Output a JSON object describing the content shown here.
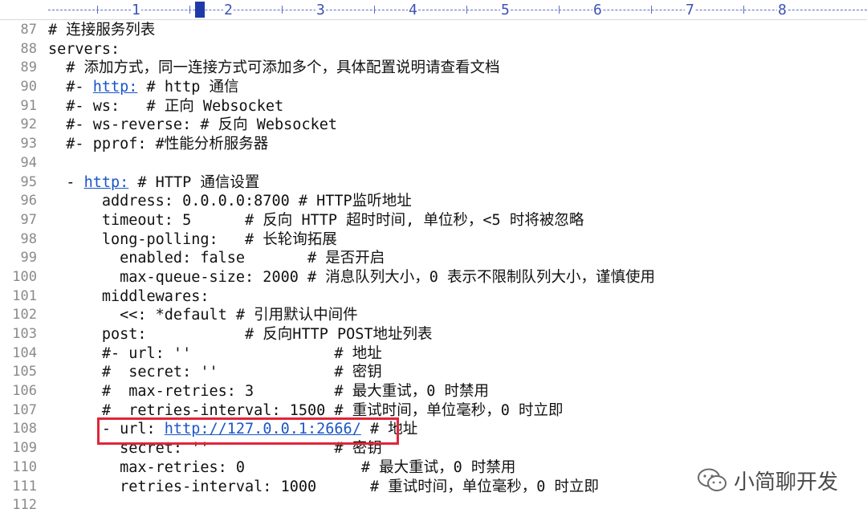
{
  "ruler": {
    "numbers": [
      "1",
      "2",
      "3",
      "4",
      "5",
      "6",
      "7",
      "8"
    ]
  },
  "lines": [
    {
      "n": "87",
      "text": "# 连接服务列表"
    },
    {
      "n": "88",
      "text": "servers:"
    },
    {
      "n": "89",
      "text": "  # 添加方式，同一连接方式可添加多个，具体配置说明请查看文档"
    },
    {
      "n": "90",
      "pre": "  #- ",
      "link": "http:",
      "post": " # http 通信"
    },
    {
      "n": "91",
      "text": "  #- ws:   # 正向 Websocket"
    },
    {
      "n": "92",
      "text": "  #- ws-reverse: # 反向 Websocket"
    },
    {
      "n": "93",
      "text": "  #- pprof: #性能分析服务器"
    },
    {
      "n": "94",
      "text": ""
    },
    {
      "n": "95",
      "pre": "  - ",
      "link": "http:",
      "post": " # HTTP 通信设置"
    },
    {
      "n": "96",
      "text": "      address: 0.0.0.0:8700 # HTTP监听地址"
    },
    {
      "n": "97",
      "text": "      timeout: 5      # 反向 HTTP 超时时间, 单位秒，<5 时将被忽略"
    },
    {
      "n": "98",
      "text": "      long-polling:   # 长轮询拓展"
    },
    {
      "n": "99",
      "text": "        enabled: false       # 是否开启"
    },
    {
      "n": "100",
      "text": "        max-queue-size: 2000 # 消息队列大小，0 表示不限制队列大小，谨慎使用"
    },
    {
      "n": "101",
      "text": "      middlewares:"
    },
    {
      "n": "102",
      "text": "        <<: *default # 引用默认中间件"
    },
    {
      "n": "103",
      "text": "      post:           # 反向HTTP POST地址列表"
    },
    {
      "n": "104",
      "text": "      #- url: ''                # 地址"
    },
    {
      "n": "105",
      "text": "      #  secret: ''             # 密钥"
    },
    {
      "n": "106",
      "text": "      #  max-retries: 3         # 最大重试，0 时禁用"
    },
    {
      "n": "107",
      "text": "      #  retries-interval: 1500 # 重试时间，单位毫秒，0 时立即"
    },
    {
      "n": "108",
      "pre": "      - url: ",
      "link": "http://127.0.0.1:2666/",
      "post": " # 地址"
    },
    {
      "n": "109",
      "text": "        secret: ''              # 密钥"
    },
    {
      "n": "110",
      "text": "        max-retries: 0             # 最大重试，0 时禁用"
    },
    {
      "n": "111",
      "text": "        retries-interval: 1000      # 重试时间，单位毫秒，0 时立即"
    },
    {
      "n": "112",
      "text": ""
    }
  ],
  "watermark": {
    "text": "小简聊开发",
    "icon": "wechat-icon"
  },
  "colors": {
    "link": "#1a56c8",
    "highlight": "#e0263a",
    "ruler": "#3b52b6"
  }
}
